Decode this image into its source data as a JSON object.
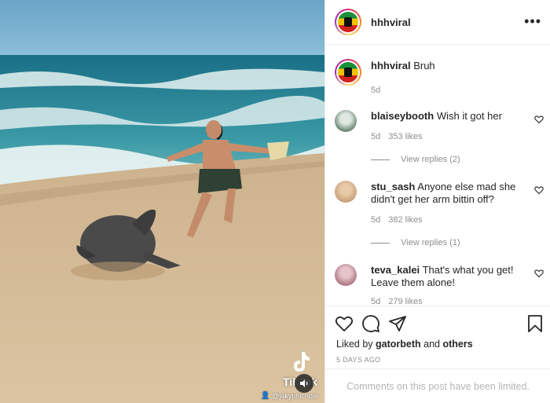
{
  "post": {
    "username": "hhhviral",
    "more_icon": "more-horizontal-icon",
    "caption_username": "hhhviral",
    "caption_text": "Bruh",
    "caption_time": "5d"
  },
  "video": {
    "watermark": "TikTok",
    "handle": "@jakynnichole",
    "mute_icon": "speaker-icon"
  },
  "comments": [
    {
      "username": "blaiseybooth",
      "text": "Wish it got her",
      "time": "5d",
      "likes": "353 likes",
      "replies": "View replies (2)",
      "avatar_color": "#6e8a76"
    },
    {
      "username": "stu_sash",
      "text": "Anyone else mad she didn't get her arm bittin off?",
      "time": "5d",
      "likes": "382 likes",
      "replies": "View replies (1)",
      "avatar_color": "#c9a27a"
    },
    {
      "username": "teva_kalei",
      "text": "That's what you get! Leave them alone!",
      "time": "5d",
      "likes": "279 likes",
      "avatar_color": "#b07a88"
    }
  ],
  "actions": {
    "liked_prefix": "Liked by ",
    "liked_user": "gatorbeth",
    "liked_mid": " and ",
    "liked_others": "others",
    "date": "5 DAYS AGO",
    "limited_text": "Comments on this post have been limited."
  }
}
